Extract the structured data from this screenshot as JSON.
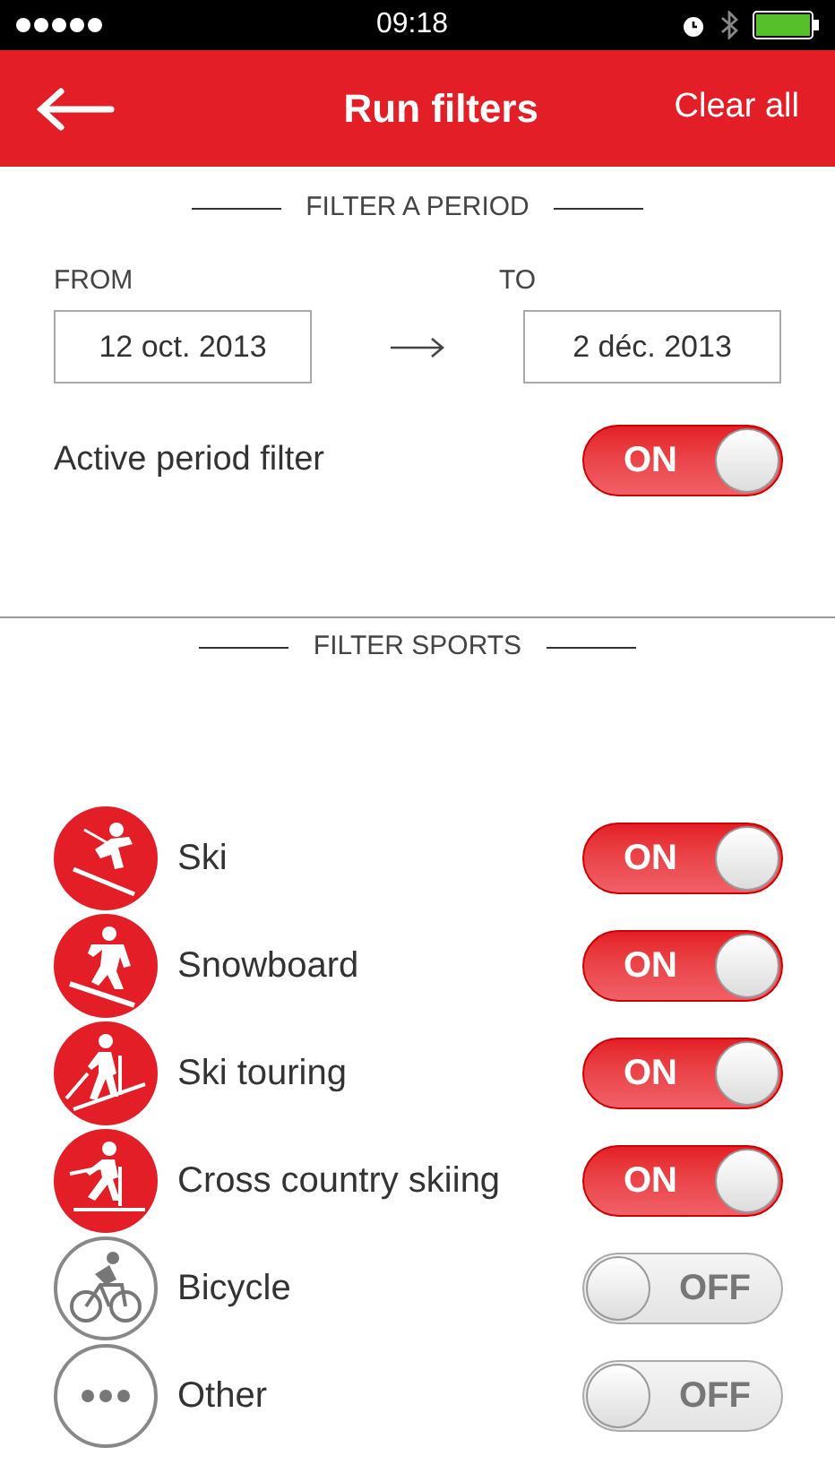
{
  "status_bar": {
    "time": "09:18"
  },
  "header": {
    "title": "Run filters",
    "action": "Clear all"
  },
  "period": {
    "heading": "FILTER A PERIOD",
    "from_label": "FROM",
    "to_label": "TO",
    "from": "12 oct. 2013",
    "to": "2 déc. 2013",
    "filter_label": "Active period filter",
    "toggle": {
      "on": true,
      "label": "ON"
    }
  },
  "sports": {
    "heading": "FILTER SPORTS",
    "items": [
      {
        "kind": "ski",
        "label": "Ski",
        "on": true,
        "toggle_label": "ON"
      },
      {
        "kind": "snowboard",
        "label": "Snowboard",
        "on": true,
        "toggle_label": "ON"
      },
      {
        "kind": "touring",
        "label": "Ski touring",
        "on": true,
        "toggle_label": "ON"
      },
      {
        "kind": "crosscountry",
        "label": "Cross country skiing",
        "on": true,
        "toggle_label": "ON"
      },
      {
        "kind": "bicycle",
        "label": "Bicycle",
        "on": false,
        "toggle_label": "OFF"
      },
      {
        "kind": "other",
        "label": "Other",
        "on": false,
        "toggle_label": "OFF"
      }
    ]
  }
}
